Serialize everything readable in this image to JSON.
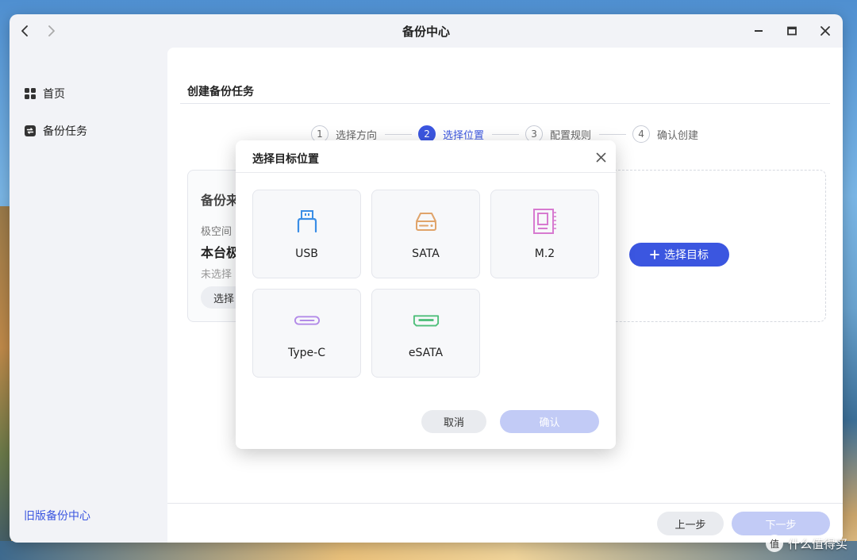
{
  "window": {
    "title": "备份中心"
  },
  "sidebar": {
    "items": [
      {
        "label": "首页",
        "icon": "grid-icon"
      },
      {
        "label": "备份任务",
        "icon": "backup-task-icon"
      }
    ],
    "legacy_link": "旧版备份中心"
  },
  "main": {
    "title": "创建备份任务",
    "steps": [
      {
        "num": "1",
        "label": "选择方向",
        "active": false
      },
      {
        "num": "2",
        "label": "选择位置",
        "active": true
      },
      {
        "num": "3",
        "label": "配置规则",
        "active": false
      },
      {
        "num": "4",
        "label": "确认创建",
        "active": false
      }
    ],
    "source_card": {
      "title": "备份来",
      "label": "极空间",
      "name": "本台极",
      "status": "未选择",
      "button": "选择"
    },
    "target_card": {
      "button": "选择目标"
    },
    "footer": {
      "prev": "上一步",
      "next": "下一步"
    }
  },
  "modal": {
    "title": "选择目标位置",
    "tiles": [
      {
        "label": "USB",
        "icon": "usb-icon",
        "color": "#3a8ee6"
      },
      {
        "label": "SATA",
        "icon": "sata-drive-icon",
        "color": "#e0a46a"
      },
      {
        "label": "M.2",
        "icon": "m2-icon",
        "color": "#d77ad0"
      },
      {
        "label": "Type-C",
        "icon": "type-c-icon",
        "color": "#b38be8"
      },
      {
        "label": "eSATA",
        "icon": "esata-icon",
        "color": "#4fbf7a"
      }
    ],
    "cancel": "取消",
    "confirm": "确认"
  },
  "watermark": {
    "logo_text": "值",
    "text": "什么值得买"
  },
  "colors": {
    "accent": "#3b56e0",
    "accent_disabled": "#c2cbf6"
  }
}
